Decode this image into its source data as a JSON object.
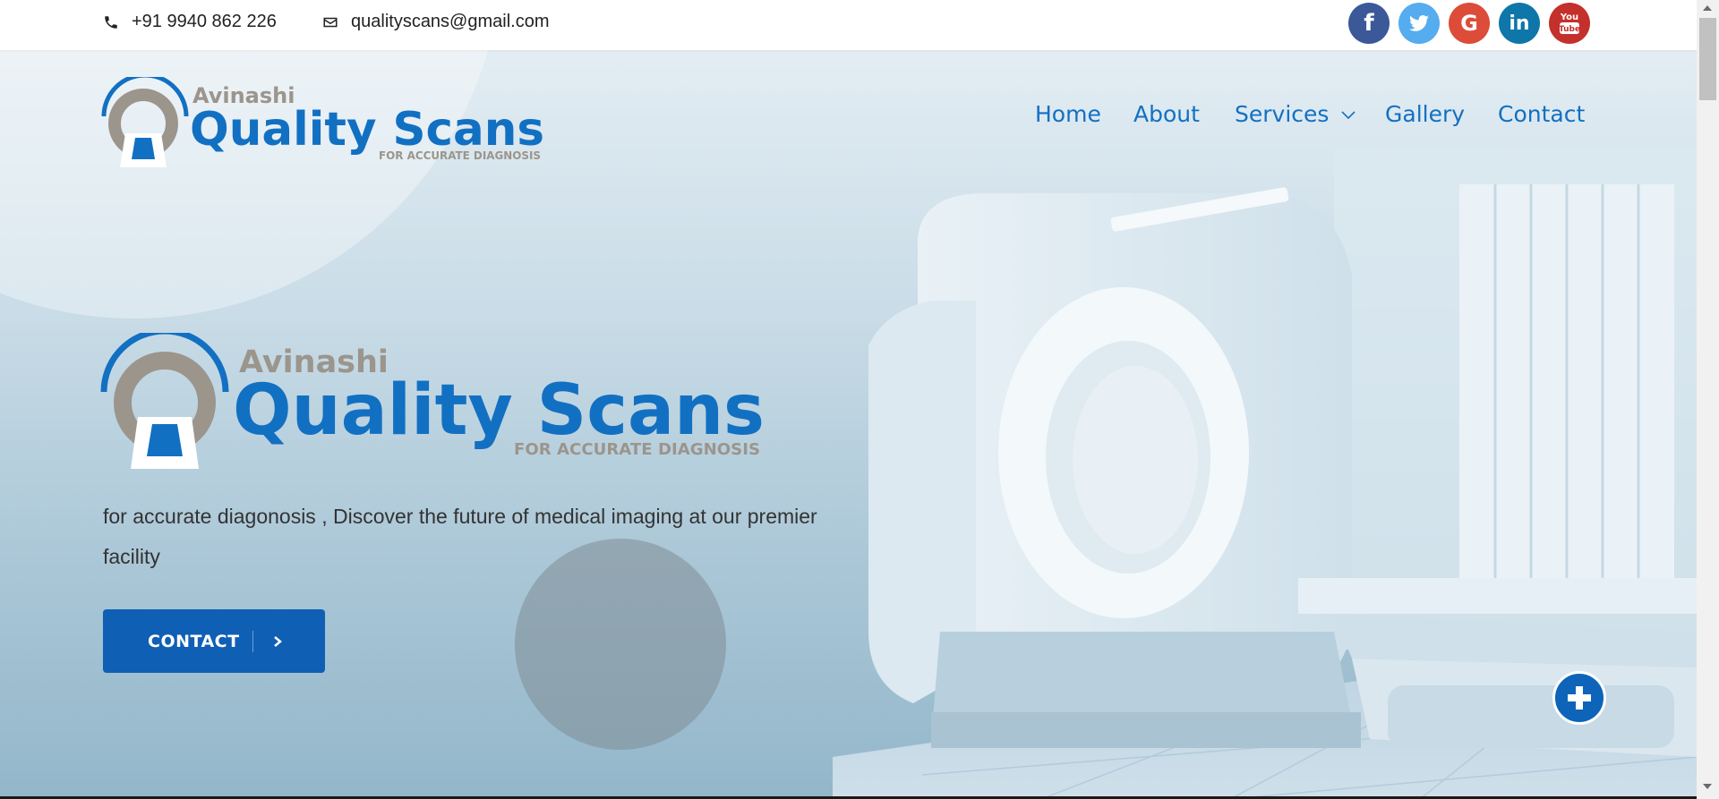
{
  "topbar": {
    "phone": "+91 9940 862 226",
    "email": "qualityscans@gmail.com",
    "social": [
      {
        "name": "facebook",
        "icon": "f",
        "color": "#3b5998"
      },
      {
        "name": "twitter",
        "icon": "twitter-bird",
        "color": "#55acee"
      },
      {
        "name": "google",
        "icon": "G",
        "color": "#dd4b39"
      },
      {
        "name": "linkedin",
        "icon": "in",
        "color": "#0e76a8"
      },
      {
        "name": "youtube",
        "icon": "You Tube",
        "color": "#c4302b"
      }
    ]
  },
  "logo": {
    "line1": "Avinashi",
    "line2": "Quality Scans",
    "tagline": "FOR ACCURATE DIAGNOSIS"
  },
  "nav": {
    "items": [
      "Home",
      "About",
      "Services",
      "Gallery",
      "Contact"
    ],
    "dropdown_item": "Services"
  },
  "hero": {
    "text": "for accurate diagonosis , Discover the future of medical imaging at our premier facility",
    "button_label": "CONTACT"
  },
  "colors": {
    "brand_blue": "#1270c2",
    "button_blue": "#0f5fb5",
    "logo_gray": "#9b958c"
  }
}
